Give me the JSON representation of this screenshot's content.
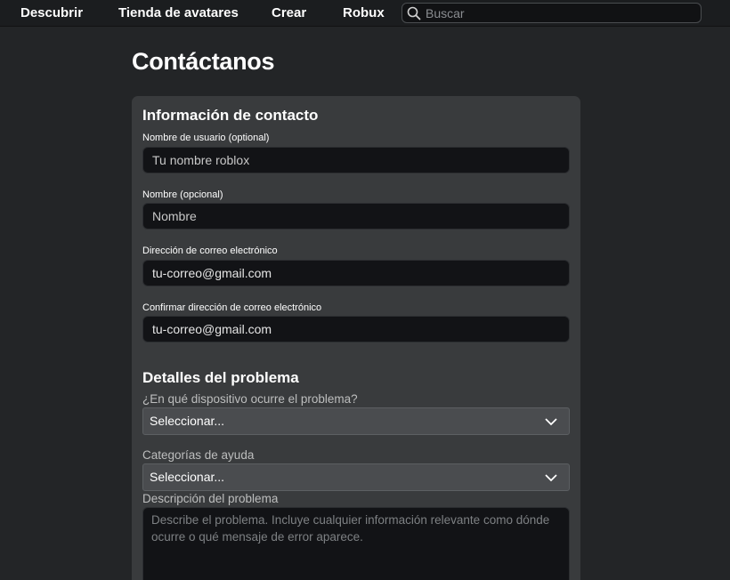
{
  "nav": {
    "items": [
      "Descubrir",
      "Tienda de avatares",
      "Crear",
      "Robux"
    ],
    "search_placeholder": "Buscar"
  },
  "page": {
    "title": "Contáctanos"
  },
  "contact": {
    "title": "Información de contacto",
    "username": {
      "label": "Nombre de usuario (optional)",
      "placeholder": "Tu nombre roblox"
    },
    "name": {
      "label": "Nombre (opcional)",
      "placeholder": "Nombre"
    },
    "email": {
      "label": "Dirección de correo electrónico",
      "value": "tu-correo@gmail.com"
    },
    "email_confirm": {
      "label": "Confirmar dirección de correo electrónico",
      "value": "tu-correo@gmail.com"
    }
  },
  "problem": {
    "title": "Detalles del problema",
    "device": {
      "label": "¿En qué dispositivo ocurre el problema?",
      "selected": "Seleccionar..."
    },
    "category": {
      "label": "Categorías de ayuda",
      "selected": "Seleccionar..."
    },
    "description": {
      "label": "Descripción del problema",
      "placeholder": "Describe el problema. Incluye cualquier información relevante como dónde ocurre o qué mensaje de error aparece."
    }
  },
  "colors": {
    "background": "#232527",
    "nav_background": "#1b1d1f",
    "panel": "#393b3d",
    "input": "#121316",
    "select": "#4a4c4f"
  }
}
